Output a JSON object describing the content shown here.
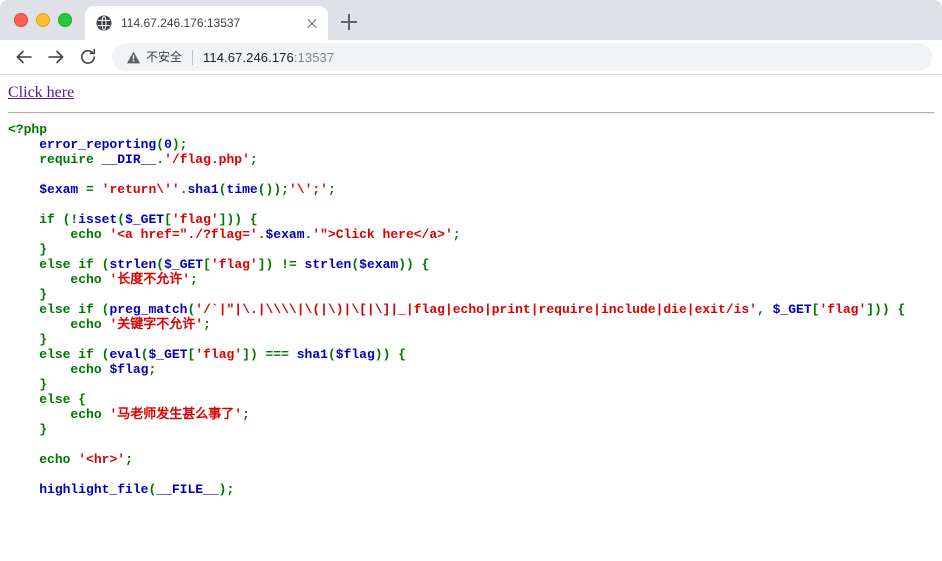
{
  "browser": {
    "window_controls": [
      {
        "name": "close",
        "color": "#ff5f57"
      },
      {
        "name": "minimize",
        "color": "#febc2e"
      },
      {
        "name": "maximize",
        "color": "#28c840"
      }
    ],
    "tab": {
      "title": "114.67.246.176:13537",
      "favicon_icon": "globe-icon",
      "close_icon": "close-icon"
    },
    "new_tab_label": "+",
    "toolbar": {
      "back_icon": "arrow-left-icon",
      "forward_icon": "arrow-right-icon",
      "reload_icon": "reload-icon",
      "security_icon": "warning-triangle-icon",
      "security_text": "不安全",
      "url_host": "114.67.246.176",
      "url_port": ":13537"
    }
  },
  "page": {
    "link_label": "Click here",
    "code_lines": [
      [
        {
          "t": "<?php",
          "c": "tok-keyword"
        }
      ],
      [
        {
          "t": "    ",
          "c": "tok-html"
        },
        {
          "t": "error_reporting",
          "c": "tok-default"
        },
        {
          "t": "(",
          "c": "tok-keyword"
        },
        {
          "t": "0",
          "c": "tok-default"
        },
        {
          "t": ");",
          "c": "tok-keyword"
        }
      ],
      [
        {
          "t": "    ",
          "c": "tok-html"
        },
        {
          "t": "require",
          "c": "tok-keyword"
        },
        {
          "t": " ",
          "c": "tok-default"
        },
        {
          "t": "__DIR__",
          "c": "tok-default"
        },
        {
          "t": ".",
          "c": "tok-keyword"
        },
        {
          "t": "'/flag.php'",
          "c": "tok-string"
        },
        {
          "t": ";",
          "c": "tok-keyword"
        }
      ],
      [
        {
          "t": "",
          "c": "tok-html"
        }
      ],
      [
        {
          "t": "    ",
          "c": "tok-html"
        },
        {
          "t": "$exam",
          "c": "tok-default"
        },
        {
          "t": " ",
          "c": "tok-default"
        },
        {
          "t": "=",
          "c": "tok-keyword"
        },
        {
          "t": " ",
          "c": "tok-default"
        },
        {
          "t": "'return\\''",
          "c": "tok-string"
        },
        {
          "t": ".",
          "c": "tok-keyword"
        },
        {
          "t": "sha1",
          "c": "tok-default"
        },
        {
          "t": "(",
          "c": "tok-keyword"
        },
        {
          "t": "time",
          "c": "tok-default"
        },
        {
          "t": "());",
          "c": "tok-keyword"
        },
        {
          "t": "'\\';'",
          "c": "tok-string"
        },
        {
          "t": ";",
          "c": "tok-keyword"
        }
      ],
      [
        {
          "t": "",
          "c": "tok-html"
        }
      ],
      [
        {
          "t": "    ",
          "c": "tok-html"
        },
        {
          "t": "if",
          "c": "tok-keyword"
        },
        {
          "t": " (!",
          "c": "tok-keyword"
        },
        {
          "t": "isset",
          "c": "tok-default"
        },
        {
          "t": "(",
          "c": "tok-keyword"
        },
        {
          "t": "$_GET",
          "c": "tok-default"
        },
        {
          "t": "[",
          "c": "tok-keyword"
        },
        {
          "t": "'flag'",
          "c": "tok-string"
        },
        {
          "t": "])) {",
          "c": "tok-keyword"
        }
      ],
      [
        {
          "t": "        ",
          "c": "tok-html"
        },
        {
          "t": "echo",
          "c": "tok-keyword"
        },
        {
          "t": " ",
          "c": "tok-default"
        },
        {
          "t": "'<a href=\"./?flag='",
          "c": "tok-string"
        },
        {
          "t": ".",
          "c": "tok-keyword"
        },
        {
          "t": "$exam",
          "c": "tok-default"
        },
        {
          "t": ".",
          "c": "tok-keyword"
        },
        {
          "t": "'\">Click here</a>'",
          "c": "tok-string"
        },
        {
          "t": ";",
          "c": "tok-keyword"
        }
      ],
      [
        {
          "t": "    }",
          "c": "tok-keyword"
        }
      ],
      [
        {
          "t": "    ",
          "c": "tok-html"
        },
        {
          "t": "else",
          "c": "tok-keyword"
        },
        {
          "t": " ",
          "c": "tok-default"
        },
        {
          "t": "if",
          "c": "tok-keyword"
        },
        {
          "t": " (",
          "c": "tok-keyword"
        },
        {
          "t": "strlen",
          "c": "tok-default"
        },
        {
          "t": "(",
          "c": "tok-keyword"
        },
        {
          "t": "$_GET",
          "c": "tok-default"
        },
        {
          "t": "[",
          "c": "tok-keyword"
        },
        {
          "t": "'flag'",
          "c": "tok-string"
        },
        {
          "t": "]) != ",
          "c": "tok-keyword"
        },
        {
          "t": "strlen",
          "c": "tok-default"
        },
        {
          "t": "(",
          "c": "tok-keyword"
        },
        {
          "t": "$exam",
          "c": "tok-default"
        },
        {
          "t": ")) {",
          "c": "tok-keyword"
        }
      ],
      [
        {
          "t": "        ",
          "c": "tok-html"
        },
        {
          "t": "echo",
          "c": "tok-keyword"
        },
        {
          "t": " ",
          "c": "tok-default"
        },
        {
          "t": "'长度不允许'",
          "c": "tok-string"
        },
        {
          "t": ";",
          "c": "tok-keyword"
        }
      ],
      [
        {
          "t": "    }",
          "c": "tok-keyword"
        }
      ],
      [
        {
          "t": "    ",
          "c": "tok-html"
        },
        {
          "t": "else",
          "c": "tok-keyword"
        },
        {
          "t": " ",
          "c": "tok-default"
        },
        {
          "t": "if",
          "c": "tok-keyword"
        },
        {
          "t": " (",
          "c": "tok-keyword"
        },
        {
          "t": "preg_match",
          "c": "tok-default"
        },
        {
          "t": "(",
          "c": "tok-keyword"
        },
        {
          "t": "'/`|\"|\\.|\\\\\\\\|\\(|\\)|\\[|\\]|_|flag|echo|print|require|include|die|exit/is'",
          "c": "tok-string"
        },
        {
          "t": ", ",
          "c": "tok-keyword"
        },
        {
          "t": "$_GET",
          "c": "tok-default"
        },
        {
          "t": "[",
          "c": "tok-keyword"
        },
        {
          "t": "'flag'",
          "c": "tok-string"
        },
        {
          "t": "])) {",
          "c": "tok-keyword"
        }
      ],
      [
        {
          "t": "        ",
          "c": "tok-html"
        },
        {
          "t": "echo",
          "c": "tok-keyword"
        },
        {
          "t": " ",
          "c": "tok-default"
        },
        {
          "t": "'关键字不允许'",
          "c": "tok-string"
        },
        {
          "t": ";",
          "c": "tok-keyword"
        }
      ],
      [
        {
          "t": "    }",
          "c": "tok-keyword"
        }
      ],
      [
        {
          "t": "    ",
          "c": "tok-html"
        },
        {
          "t": "else",
          "c": "tok-keyword"
        },
        {
          "t": " ",
          "c": "tok-default"
        },
        {
          "t": "if",
          "c": "tok-keyword"
        },
        {
          "t": " (",
          "c": "tok-keyword"
        },
        {
          "t": "eval",
          "c": "tok-default"
        },
        {
          "t": "(",
          "c": "tok-keyword"
        },
        {
          "t": "$_GET",
          "c": "tok-default"
        },
        {
          "t": "[",
          "c": "tok-keyword"
        },
        {
          "t": "'flag'",
          "c": "tok-string"
        },
        {
          "t": "]) === ",
          "c": "tok-keyword"
        },
        {
          "t": "sha1",
          "c": "tok-default"
        },
        {
          "t": "(",
          "c": "tok-keyword"
        },
        {
          "t": "$flag",
          "c": "tok-default"
        },
        {
          "t": ")) {",
          "c": "tok-keyword"
        }
      ],
      [
        {
          "t": "        ",
          "c": "tok-html"
        },
        {
          "t": "echo",
          "c": "tok-keyword"
        },
        {
          "t": " ",
          "c": "tok-default"
        },
        {
          "t": "$flag",
          "c": "tok-default"
        },
        {
          "t": ";",
          "c": "tok-keyword"
        }
      ],
      [
        {
          "t": "    }",
          "c": "tok-keyword"
        }
      ],
      [
        {
          "t": "    ",
          "c": "tok-html"
        },
        {
          "t": "else",
          "c": "tok-keyword"
        },
        {
          "t": " {",
          "c": "tok-keyword"
        }
      ],
      [
        {
          "t": "        ",
          "c": "tok-html"
        },
        {
          "t": "echo",
          "c": "tok-keyword"
        },
        {
          "t": " ",
          "c": "tok-default"
        },
        {
          "t": "'马老师发生甚么事了'",
          "c": "tok-string"
        },
        {
          "t": ";",
          "c": "tok-keyword"
        }
      ],
      [
        {
          "t": "    }",
          "c": "tok-keyword"
        }
      ],
      [
        {
          "t": "",
          "c": "tok-html"
        }
      ],
      [
        {
          "t": "    ",
          "c": "tok-html"
        },
        {
          "t": "echo",
          "c": "tok-keyword"
        },
        {
          "t": " ",
          "c": "tok-default"
        },
        {
          "t": "'<hr>'",
          "c": "tok-string"
        },
        {
          "t": ";",
          "c": "tok-keyword"
        }
      ],
      [
        {
          "t": "",
          "c": "tok-html"
        }
      ],
      [
        {
          "t": "    ",
          "c": "tok-html"
        },
        {
          "t": "highlight_file",
          "c": "tok-default"
        },
        {
          "t": "(",
          "c": "tok-keyword"
        },
        {
          "t": "__FILE__",
          "c": "tok-default"
        },
        {
          "t": ");",
          "c": "tok-keyword"
        }
      ]
    ]
  }
}
